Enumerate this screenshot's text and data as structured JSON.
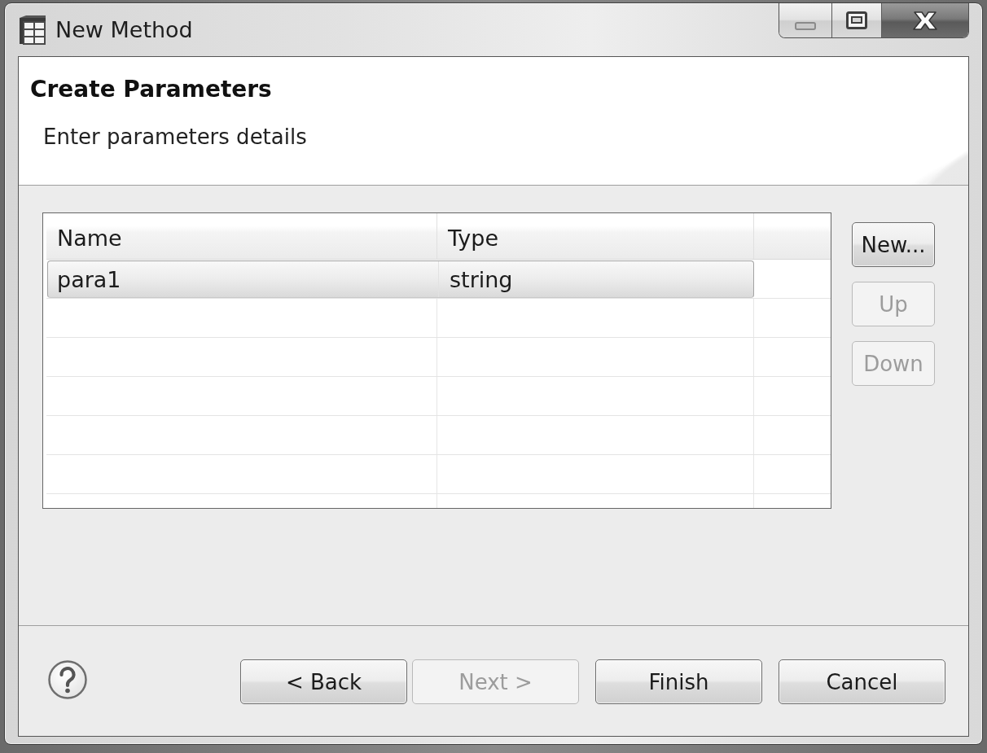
{
  "window": {
    "title": "New Method"
  },
  "header": {
    "title": "Create Parameters",
    "description": "Enter parameters details"
  },
  "table": {
    "columns": [
      "Name",
      "Type"
    ],
    "rows": [
      {
        "cells": [
          "para1",
          "string"
        ],
        "selected": true
      }
    ]
  },
  "table_buttons": [
    {
      "label": "New...",
      "disabled": false
    },
    {
      "label": "Up",
      "disabled": true
    },
    {
      "label": "Down",
      "disabled": true
    }
  ],
  "footer": {
    "buttons": [
      {
        "label": "< Back",
        "disabled": false
      },
      {
        "label": "Next >",
        "disabled": true
      },
      {
        "label": "Finish",
        "disabled": false
      },
      {
        "label": "Cancel",
        "disabled": false
      }
    ]
  }
}
